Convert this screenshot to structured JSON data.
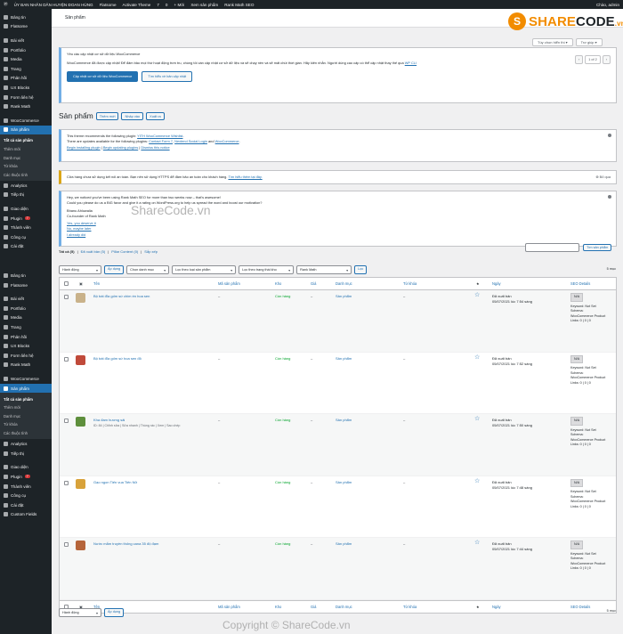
{
  "adminbar": {
    "site": "ỦY BAN NHÂN DÂN HUYỆN ĐOAN HÙNG",
    "theme": "Flatsome",
    "activate": "Activate Theme",
    "updates": "7",
    "comments": "0",
    "new": "+ Mới",
    "view": "Xem sản phẩm",
    "rankmath": "Rank Math SEO",
    "greet": "Chào, admin"
  },
  "sidebar": {
    "group1": [
      "Bảng tin",
      "Flatsome"
    ],
    "group2": [
      "Bài viết",
      "Portfolio",
      "Media",
      "Trang",
      "Phản hồi",
      "UX Blocks",
      "Form liên hệ",
      "Rank Math"
    ],
    "woo": "WooCommerce",
    "products": "Sản phẩm",
    "sub": [
      "Tất cả sản phẩm",
      "Thêm mới",
      "Danh mục",
      "Từ khóa",
      "Các thuộc tính"
    ],
    "group3": [
      "Analytics",
      "Tiếp thị"
    ],
    "group4": [
      "Giao diện",
      "Plugin",
      "Thành viên",
      "Công cụ",
      "Cài đặt"
    ],
    "plugin_badge": "7",
    "custom_fields": "Custom Fields"
  },
  "header": {
    "title": "Sản phẩm"
  },
  "logo": {
    "left": "SHARE",
    "right": "CODE",
    "suffix": ".vn"
  },
  "screen": {
    "options": "Tùy chọn hiển thị ▾",
    "help": "Trợ giúp ▾"
  },
  "notice1": {
    "title": "Yêu cầu cập nhật cơ sở dữ liệu WooCommerce",
    "body": "WooCommerce đã được cập nhật! Để đảm bảo mọi thứ hoạt động trơn tru, chúng tôi cần cập nhật cơ sở dữ liệu và sẽ chạy nền và sẽ mất chút thời gian. Hãy kiên nhẫn. Người dùng cao cấp có thể cập nhật thay thế qua",
    "link": "WP CLI",
    "pager": "1 of 2",
    "btn1": "Cập nhật cơ sở dữ liệu WooCommerce",
    "btn2": "Tìm hiểu về bản cập nhật"
  },
  "page": {
    "title": "Sản phẩm",
    "add": "Thêm mới",
    "import": "Nhập vào",
    "export": "Xuất ra"
  },
  "notice2": {
    "l1": "This theme recommends the following plugin:",
    "l1link": "YITH WooCommerce Wishlist",
    "l2": "There are updates available for the following plugins:",
    "l2a": "Contact Form 7",
    "l2b": "Nextend Social Login",
    "l2and": "and",
    "l2c": "WooCommerce",
    "l3a": "Begin installing plugin",
    "l3b": "Begin updating plugins",
    "l3c": "Dismiss this notice"
  },
  "notice3": {
    "text": "Cửa hàng chưa sử dụng kết nối an toàn. Bạn nên sử dụng HTTPS để đảm bảo an toàn cho khách hàng.",
    "link": "Tìm hiểu thêm tại đây.",
    "dismiss": "Bỏ qua"
  },
  "notice4": {
    "l1": "Hey, we noticed you've been using Rank Math SEO for more than two weeks now – that's awesome!",
    "l2": "Could you please do us a BIG favor and give it a rating on WordPress.org to help us spread the word and boost our motivation?",
    "l3": "Bhanu Ahluwalia",
    "l4": "Co-founder of Rank Math",
    "a1": "Yes, you deserve it",
    "a2": "No, maybe later",
    "a3": "I already did"
  },
  "watermarks": [
    "ShareCode.vn",
    "Copyright © ShareCode.vn"
  ],
  "status": {
    "all": "Tất cả (5)",
    "published": "Đã xuất bản (5)",
    "pillar": "Pillar Content (0)",
    "sort": "Sắp xếp"
  },
  "search_btn": "Tìm sản phẩm",
  "filters": {
    "bulk": "Hành động",
    "apply": "Áp dụng",
    "cat": "Chọn danh mục",
    "type": "Lọc theo loại sản phẩm",
    "stock": "Lọc theo trạng thái kho",
    "rank": "Rank Math",
    "filter": "Lọc"
  },
  "count": "5 mục",
  "cols": {
    "name": "Tên",
    "sku": "Mã sản phẩm",
    "stock": "Kho",
    "price": "Giá",
    "cat": "Danh mục",
    "tag": "Từ khóa",
    "date": "Ngày",
    "seo": "SEO Details"
  },
  "rows": [
    {
      "name": "Bộ bát đĩa gốm sứ chim én hoa sen",
      "sku": "–",
      "stock": "Còn hàng",
      "price": "–",
      "cat": "Sản phẩm",
      "tag": "–",
      "status": "Đã xuất bản",
      "date": "05/07/2021 lúc 7:54 sáng",
      "actions": ""
    },
    {
      "name": "Bộ bát đĩa gốm sứ hoa sen đỏ",
      "sku": "–",
      "stock": "Còn hàng",
      "price": "–",
      "cat": "Sản phẩm",
      "tag": "–",
      "status": "Đã xuất bản",
      "date": "05/07/2021 lúc 7:52 sáng",
      "actions": ""
    },
    {
      "name": "Kha đam hương sải",
      "sku": "–",
      "stock": "Còn hàng",
      "price": "–",
      "cat": "Sản phẩm",
      "tag": "–",
      "status": "Đã xuất bản",
      "date": "05/07/2021 lúc 7:50 sáng",
      "actions": "ID: 84 | Chỉnh sửa | Sửa nhanh | Thùng rác | Xem | Sao chép"
    },
    {
      "name": "Gạo ngon Tiến vua Tiến Nữ",
      "sku": "–",
      "stock": "Còn hàng",
      "price": "–",
      "cat": "Sản phẩm",
      "tag": "–",
      "status": "Đã xuất bản",
      "date": "05/07/2021 lúc 7:48 sáng",
      "actions": ""
    },
    {
      "name": "Nước mắm truyền thống cana 35 độ đạm",
      "sku": "–",
      "stock": "Còn hàng",
      "price": "–",
      "cat": "Sản phẩm",
      "tag": "–",
      "status": "Đã xuất bản",
      "date": "05/07/2021 lúc 7:44 sáng",
      "actions": ""
    }
  ],
  "seo": {
    "na": "N/A",
    "kw": "Keyword: Not Set",
    "schema": "Schema:",
    "schema_val": "WooCommerce Product",
    "links": "Links: 0 | 0 | 0"
  }
}
